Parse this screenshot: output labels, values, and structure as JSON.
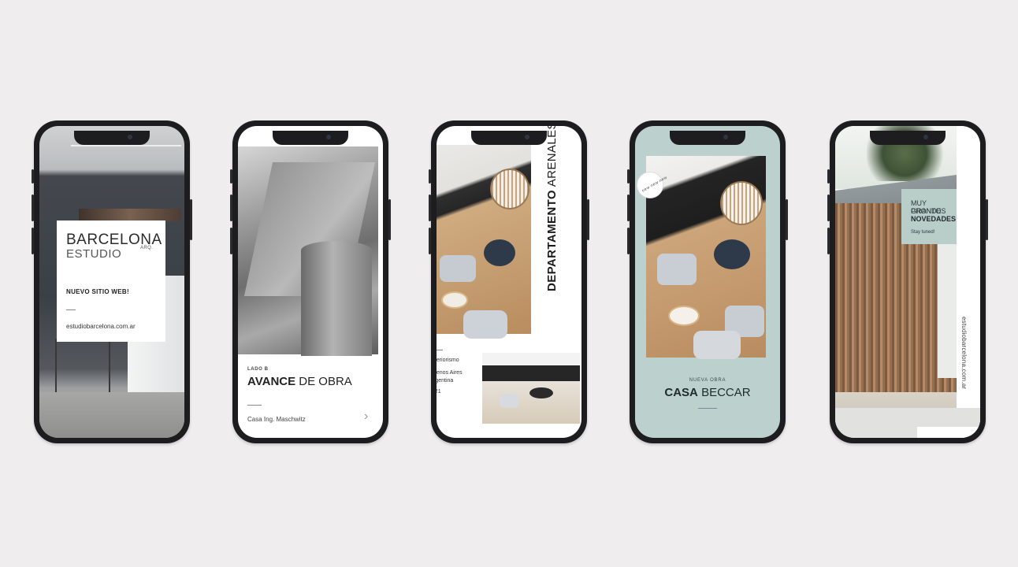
{
  "phones": [
    {
      "brand_line1": "BARCELONA",
      "brand_line2": "ESTUDIO",
      "brand_suffix": "ARQ.",
      "tagline": "NUEVO SITIO WEB!",
      "url": "estudiobarcelona.com.ar"
    },
    {
      "label": "LADO B",
      "title_bold": "AVANCE",
      "title_regular": "DE OBRA",
      "subtitle": "Casa Ing. Maschwitz",
      "arrow_icon": "chevron-right-icon"
    },
    {
      "title_bold": "DEPARTAMENTO",
      "title_regular": "ARENALES",
      "info_line1": "nteriorismo",
      "info_line2": "uenos Aires",
      "info_line3": "rgentina",
      "info_line4": "021"
    },
    {
      "badge_text": "new new new",
      "label": "NUEVA OBRA",
      "title_bold": "CASA",
      "title_regular": "BECCAR"
    },
    {
      "line1": "MUY PRONTO",
      "line2": "GRANDES",
      "line3": "NOVEDADES",
      "line4": "Stay tuned!",
      "url": "estudiobarcelona.com.ar"
    }
  ],
  "colors": {
    "background": "#efedee",
    "phone_frame": "#1d1d1f",
    "sage": "#bcd1ce"
  }
}
